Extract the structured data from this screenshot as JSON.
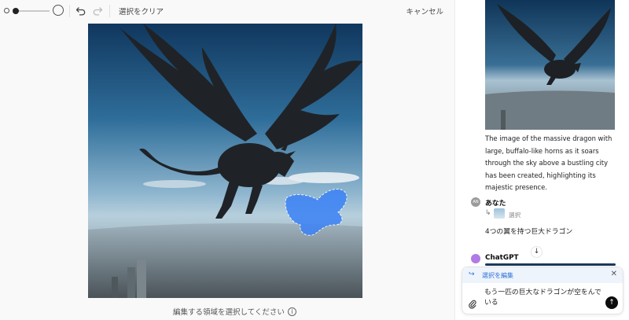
{
  "toolbar": {
    "clear_selection": "選択をクリア",
    "cancel": "キャンセル"
  },
  "editor": {
    "hint": "編集する領域を選択してください"
  },
  "chat": {
    "assistant_message": "The image of the massive dragon with large, buffalo-like horns as it soars through the sky above a bustling city has been created, highlighting its majestic presence.",
    "user_name": "あなた",
    "user_avatar_text": "AN",
    "selection_label": "選択",
    "user_message": "4つの翼を持つ巨大ドラゴン",
    "assistant_name": "ChatGPT"
  },
  "composer": {
    "edit_label": "選択を編集",
    "input_text": "もう一匹の巨大なドラゴンが空をんでいる"
  },
  "colors": {
    "selection_mask": "#3b82f6",
    "accent_blue": "#2f6fd6"
  },
  "icons": [
    "brush-size-small-icon",
    "brush-size-large-icon",
    "undo-icon",
    "redo-icon",
    "info-icon",
    "reply-arrow-icon",
    "close-icon",
    "paperclip-icon",
    "send-arrow-icon",
    "scroll-down-icon"
  ]
}
